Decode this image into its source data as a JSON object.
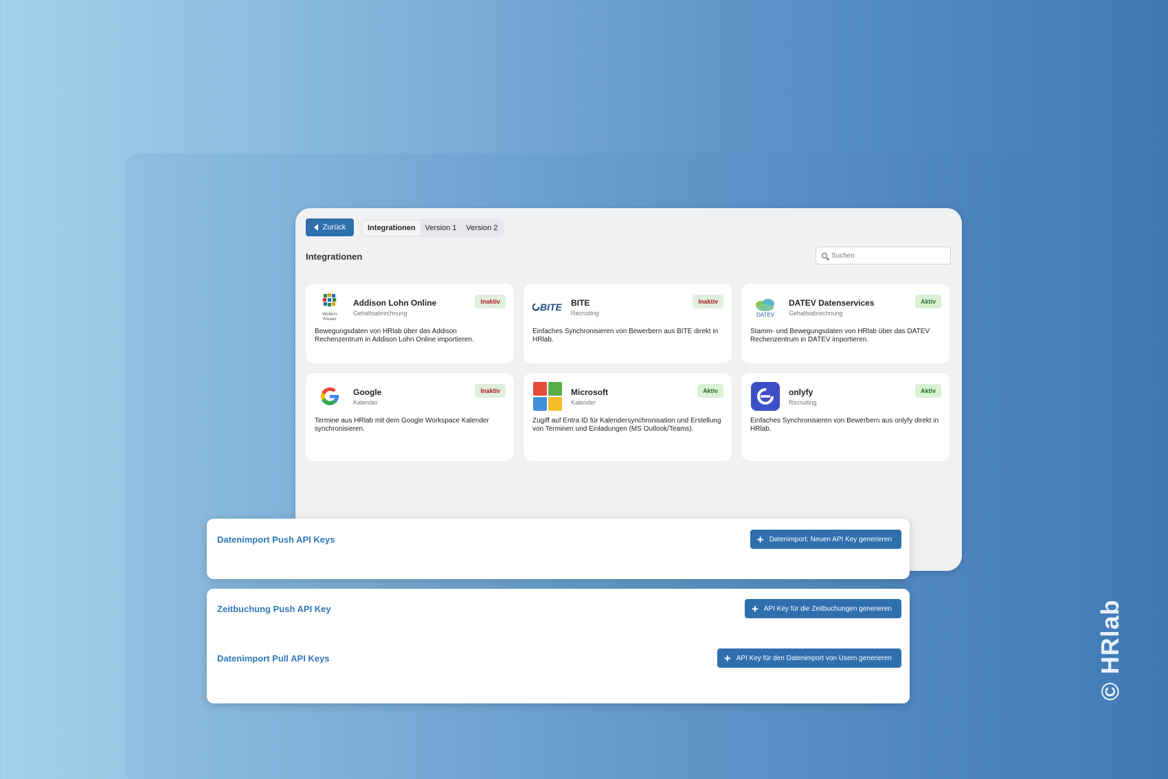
{
  "app": {
    "back_label": "Zurück",
    "tabs": [
      {
        "label": "Integrationen"
      },
      {
        "label": "Version 1"
      },
      {
        "label": "Version 2"
      }
    ],
    "section_title": "Integrationen",
    "search_placeholder": "Suchen"
  },
  "integrations": [
    {
      "name": "Addison Lohn Online",
      "category": "Gehaltsabrechnung",
      "status": "Inaktiv",
      "description": "Bewegungsdaten von HRlab über das Addison Rechenzentrum in Addison Lohn Online importieren.",
      "logo_text": "Wolters Kluwer"
    },
    {
      "name": "BITE",
      "category": "Recruiting",
      "status": "Inaktiv",
      "description": "Einfaches Synchronisieren von Bewerbern aus BITE direkt in HRlab.",
      "logo_text": "BITE"
    },
    {
      "name": "DATEV Datenservices",
      "category": "Gehaltsabrechnung",
      "status": "Aktiv",
      "description": "Stamm- und Bewegungsdaten von HRlab über das DATEV Rechenzentrum in DATEV importieren.",
      "logo_text": "DATEV"
    },
    {
      "name": "Google",
      "category": "Kalender",
      "status": "Inaktiv",
      "description": "Termine aus HRlab mit dem Google Workspace Kalender synchronisieren.",
      "logo_text": "G"
    },
    {
      "name": "Microsoft",
      "category": "Kalender",
      "status": "Aktiv",
      "description": "Zugiff auf Entra ID für Kalendersynchronisation und Erstellung von Terminen und Einladungen (MS Outlook/Teams).",
      "logo_text": ""
    },
    {
      "name": "onlyfy",
      "category": "Recruiting",
      "status": "Aktiv",
      "description": "Einfaches Synchronisieren von Bewerbern aus onlyfy direkt in HRlab.",
      "logo_text": ""
    }
  ],
  "api_keys": {
    "push_title": "Datenimport Push API Keys",
    "push_button": "Datenimport: Neuen API Key generieren",
    "time_title": "Zeitbuchung Push API Key",
    "time_button": "API Key für die Zeitbuchungen generieren",
    "pull_title": "Datenimport Pull API Keys",
    "pull_button": "API Key für den Datenimport von Usern generieren"
  },
  "watermark": "© HRlab",
  "colors": {
    "accent": "#2f6fae",
    "link": "#2f78b8",
    "inactive_text": "#b02020",
    "active_text": "#2b6a2b"
  }
}
